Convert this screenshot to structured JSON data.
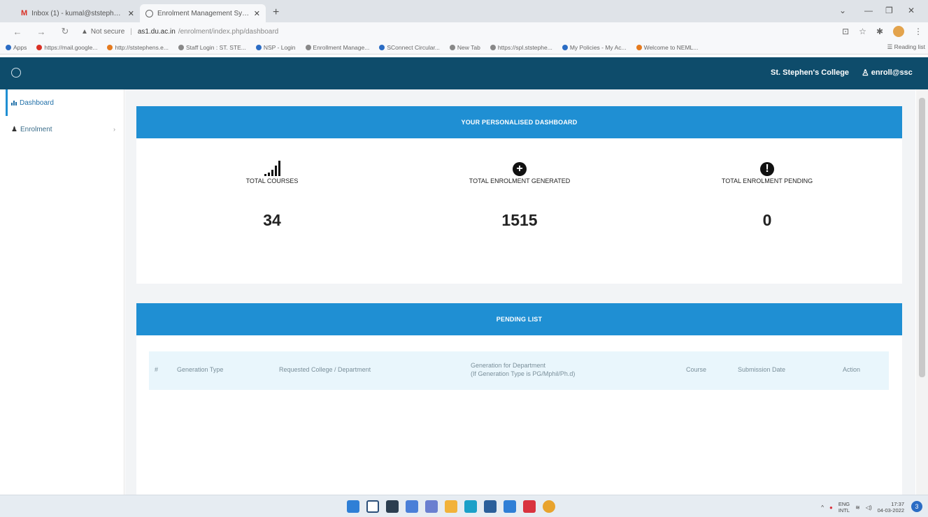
{
  "browser": {
    "tabs": [
      {
        "label": "Inbox (1) - kumal@ststephens.ac",
        "icon": "gmail-icon"
      },
      {
        "label": "Enrolment Management System",
        "icon": "globe-icon"
      }
    ],
    "address": {
      "security": "Not secure",
      "host": "as1.du.ac.in",
      "path": "/enrolment/index.php/dashboard"
    },
    "bookmarks": [
      "Apps",
      "https://mail.google...",
      "http://ststephens.e...",
      "Staff Login : ST. STE...",
      "NSP - Login",
      "Enrollment Manage...",
      "SConnect Circular...",
      "New Tab",
      "https://spl.ststephe...",
      "My Policies - My Ac...",
      "Welcome to NEML..."
    ],
    "reading_list": "Reading list"
  },
  "header": {
    "college": "St. Stephen's College",
    "user": "enroll@ssc"
  },
  "sidebar": {
    "items": [
      {
        "label": "Dashboard"
      },
      {
        "label": "Enrolment"
      }
    ]
  },
  "dashboard": {
    "banner": "YOUR PERSONALISED DASHBOARD",
    "stats": [
      {
        "label": "TOTAL COURSES",
        "value": "34"
      },
      {
        "label": "TOTAL ENROLMENT GENERATED",
        "value": "1515"
      },
      {
        "label": "TOTAL ENROLMENT PENDING",
        "value": "0"
      }
    ]
  },
  "pending": {
    "banner": "PENDING LIST",
    "columns": [
      "#",
      "Generation Type",
      "Requested College / Department",
      "Generation for Department",
      "(If Generation Type is PG/Mphil/Ph.d)",
      "Course",
      "Submission Date",
      "Action"
    ]
  },
  "taskbar": {
    "lang_top": "ENG",
    "lang_bottom": "INTL",
    "time": "17:37",
    "date": "04-03-2022",
    "notifications": "3"
  }
}
